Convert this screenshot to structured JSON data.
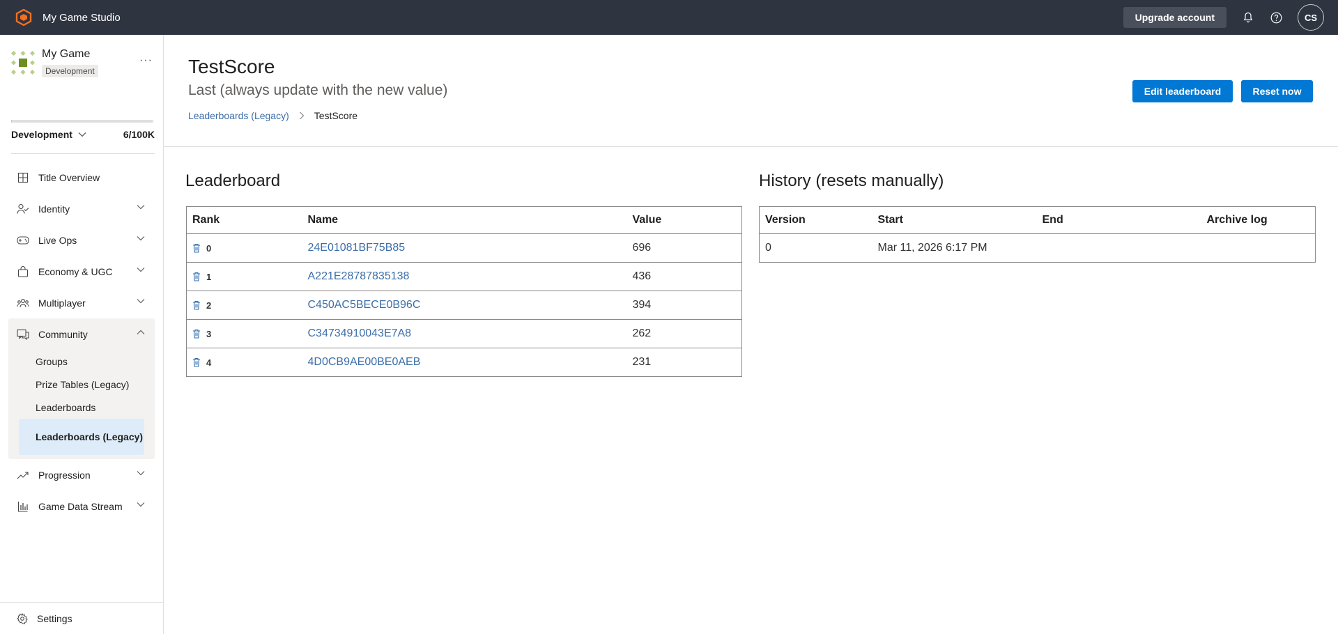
{
  "app": {
    "title": "My Game Studio",
    "logo_icon": "studio-logo-icon",
    "brand_color": "#f36f21"
  },
  "topbar": {
    "upgrade_label": "Upgrade account",
    "avatar_initials": "CS"
  },
  "sidebar": {
    "game_name": "My Game",
    "environment_badge": "Development",
    "environment_selected": "Development",
    "usage_text": "6/100K",
    "usage_fraction": 6e-05,
    "nav": [
      {
        "label": "Title Overview",
        "icon": "grid-icon"
      },
      {
        "label": "Identity",
        "icon": "people-icon"
      },
      {
        "label": "Live Ops",
        "icon": "gamepad-icon"
      },
      {
        "label": "Economy & UGC",
        "icon": "bag-icon"
      },
      {
        "label": "Multiplayer",
        "icon": "group-icon"
      },
      {
        "label": "Community",
        "icon": "chat-icon"
      },
      {
        "label": "Progression",
        "icon": "trend-icon"
      },
      {
        "label": "Game Data Stream",
        "icon": "bar-chart-icon"
      }
    ],
    "community_items": [
      {
        "label": "Groups"
      },
      {
        "label": "Prize Tables (Legacy)"
      },
      {
        "label": "Leaderboards"
      },
      {
        "label": "Leaderboards (Legacy)"
      }
    ],
    "settings_label": "Settings"
  },
  "page": {
    "title": "TestScore",
    "subtitle": "Last (always update with the new value)",
    "breadcrumb": {
      "parent": "Leaderboards (Legacy)",
      "current": "TestScore"
    },
    "edit_button": "Edit leaderboard",
    "reset_button": "Reset now"
  },
  "leaderboard": {
    "title": "Leaderboard",
    "columns": [
      "Rank",
      "Name",
      "Value"
    ],
    "rows": [
      {
        "rank": "0",
        "name": "24E01081BF75B85",
        "value": "696"
      },
      {
        "rank": "1",
        "name": "A221E28787835138",
        "value": "436"
      },
      {
        "rank": "2",
        "name": "C450AC5BECE0B96C",
        "value": "394"
      },
      {
        "rank": "3",
        "name": "C34734910043E7A8",
        "value": "262"
      },
      {
        "rank": "4",
        "name": "4D0CB9AE00BE0AEB",
        "value": "231"
      }
    ]
  },
  "history": {
    "title": "History (resets manually)",
    "columns": [
      "Version",
      "Start",
      "End",
      "Archive log"
    ],
    "rows": [
      {
        "version": "0",
        "start": "Mar 11, 2026 6:17 PM",
        "end": "",
        "archive_log": ""
      }
    ]
  }
}
